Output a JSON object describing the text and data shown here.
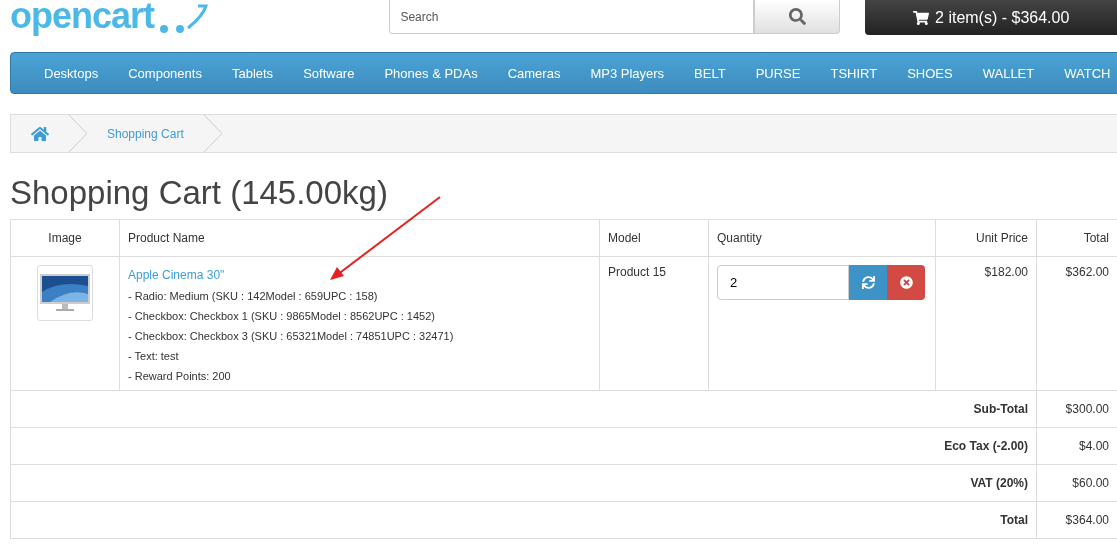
{
  "logo": {
    "text": "opencart"
  },
  "search": {
    "placeholder": "Search"
  },
  "cart_button": {
    "label": "2 item(s) - $364.00"
  },
  "nav": [
    "Desktops",
    "Components",
    "Tablets",
    "Software",
    "Phones & PDAs",
    "Cameras",
    "MP3 Players",
    "BELT",
    "PURSE",
    "TSHIRT",
    "SHOES",
    "WALLET",
    "WATCH"
  ],
  "breadcrumb": [
    "Shopping Cart"
  ],
  "heading": "Shopping Cart (145.00kg)",
  "table": {
    "columns": [
      "Image",
      "Product Name",
      "Model",
      "Quantity",
      "Unit Price",
      "Total"
    ],
    "rows": [
      {
        "product": "Apple Cinema 30\"",
        "options": [
          "- Radio: Medium (SKU : 142Model : 659UPC : 158)",
          "- Checkbox: Checkbox 1 (SKU : 9865Model : 8562UPC : 1452)",
          "- Checkbox: Checkbox 3 (SKU : 65321Model : 74851UPC : 32471)",
          "- Text: test",
          "- Reward Points: 200"
        ],
        "model": "Product 15",
        "quantity": "2",
        "unit_price": "$182.00",
        "total": "$362.00"
      }
    ]
  },
  "totals": [
    {
      "label": "Sub-Total",
      "value": "$300.00"
    },
    {
      "label": "Eco Tax (-2.00)",
      "value": "$4.00"
    },
    {
      "label": "VAT (20%)",
      "value": "$60.00"
    },
    {
      "label": "Total",
      "value": "$364.00"
    }
  ]
}
